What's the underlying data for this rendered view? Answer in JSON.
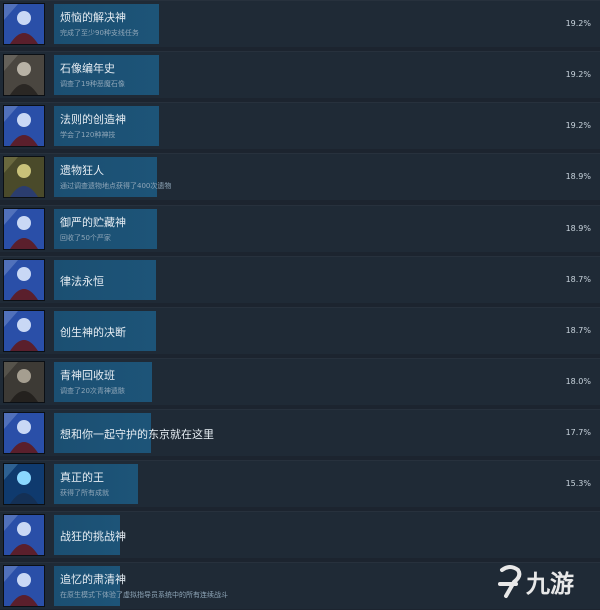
{
  "achievements": [
    {
      "title": "烦恼的解决神",
      "desc": "完成了至少90种支线任务",
      "percent": "19.2%",
      "progress": 0.192,
      "icon": "character-portrait-icon"
    },
    {
      "title": "石像编年史",
      "desc": "调查了19种恶魔石像",
      "percent": "19.2%",
      "progress": 0.192,
      "icon": "stone-statue-icon"
    },
    {
      "title": "法则的创造神",
      "desc": "学会了120种神技",
      "percent": "19.2%",
      "progress": 0.192,
      "icon": "character-portrait-icon"
    },
    {
      "title": "遗物狂人",
      "desc": "通过调查遗物地点获得了400次遗物",
      "percent": "18.9%",
      "progress": 0.189,
      "icon": "relic-scene-icon"
    },
    {
      "title": "御严的贮藏神",
      "desc": "回收了50个严家",
      "percent": "18.9%",
      "progress": 0.189,
      "icon": "character-portrait-icon"
    },
    {
      "title": "律法永恒",
      "desc": "",
      "percent": "18.7%",
      "progress": 0.187,
      "icon": "character-portrait-icon"
    },
    {
      "title": "创生神的决断",
      "desc": "",
      "percent": "18.7%",
      "progress": 0.187,
      "icon": "character-portrait-icon"
    },
    {
      "title": "青神回收班",
      "desc": "调查了20次青神遗骸",
      "percent": "18.0%",
      "progress": 0.18,
      "icon": "remains-scene-icon"
    },
    {
      "title": "想和你一起守护的东京就在这里",
      "desc": "",
      "percent": "17.7%",
      "progress": 0.177,
      "icon": "character-portrait-icon"
    },
    {
      "title": "真正的王",
      "desc": "获得了所有成就",
      "percent": "15.3%",
      "progress": 0.153,
      "icon": "glowing-light-icon"
    },
    {
      "title": "战狂的挑战神",
      "desc": "",
      "percent": "",
      "progress": 0.12,
      "icon": "character-portrait-icon"
    },
    {
      "title": "追忆的肃清神",
      "desc": "在原生模式下体验了虚拟指导员系统中的所有连续战斗",
      "percent": "",
      "progress": 0.12,
      "icon": "character-portrait-icon"
    }
  ],
  "watermark": {
    "text": "九游",
    "icon": "jiuyou-logo-icon"
  },
  "colors": {
    "background": "#1c242f",
    "row": "#1f2a36",
    "bar": "#1b4f72",
    "title": "#e6edf3",
    "desc": "#8fa6b8"
  }
}
